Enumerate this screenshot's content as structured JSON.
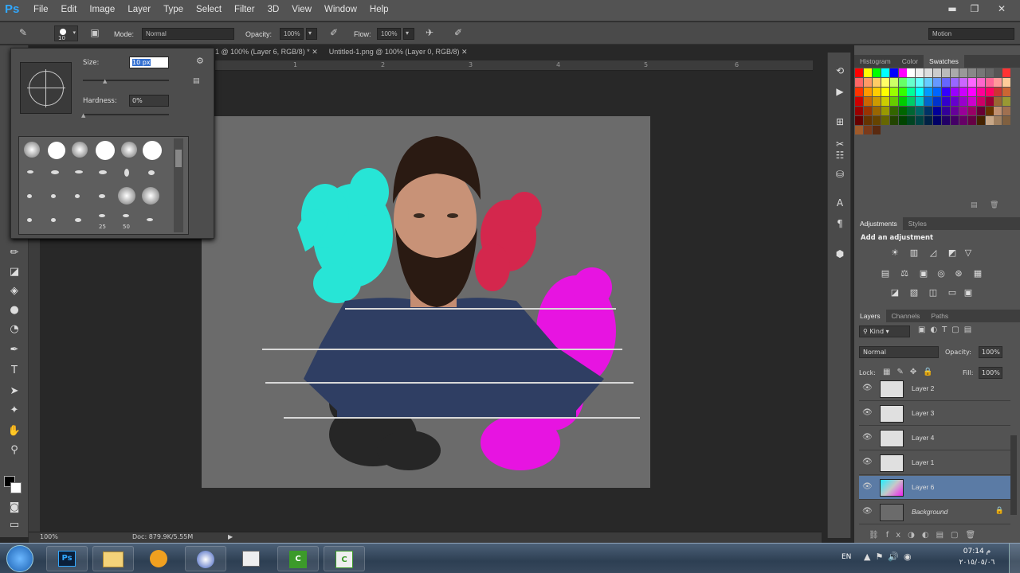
{
  "app": {
    "logo": "Ps",
    "menus": [
      "File",
      "Edit",
      "Image",
      "Layer",
      "Type",
      "Select",
      "Filter",
      "3D",
      "View",
      "Window",
      "Help"
    ]
  },
  "options_bar": {
    "brush_size": "10",
    "mode_label": "Mode:",
    "mode_value": "Normal",
    "opacity_label": "Opacity:",
    "opacity_value": "100%",
    "flow_label": "Flow:",
    "flow_value": "100%",
    "workspace": "Motion"
  },
  "brush_popup": {
    "size_label": "Size:",
    "size_value": "10 px",
    "hardness_label": "Hardness:",
    "hardness_value": "0%",
    "preset_numbers": [
      "25",
      "50"
    ]
  },
  "doc_tabs": [
    "1 @ 100% (Layer 6, RGB/8) *",
    "Untitled-1.png @ 100% (Layer 0, RGB/8)"
  ],
  "ruler_ticks": [
    "1",
    "2",
    "3",
    "4",
    "5",
    "6"
  ],
  "status": {
    "zoom": "100%",
    "doc_size": "Doc: 879.9K/5.55M"
  },
  "panels": {
    "color_tabs": [
      "Histogram",
      "Color",
      "Swatches"
    ],
    "adjust_tabs": [
      "Adjustments",
      "Styles"
    ],
    "adjust_hint": "Add an adjustment",
    "layer_tabs": [
      "Layers",
      "Channels",
      "Paths"
    ],
    "kind_label": "Kind",
    "blend_mode": "Normal",
    "opacity_label": "Opacity:",
    "opacity_value": "100%",
    "lock_label": "Lock:",
    "fill_label": "Fill:",
    "fill_value": "100%",
    "layers": [
      {
        "name": "Layer 2",
        "selected": false
      },
      {
        "name": "Layer 3",
        "selected": false
      },
      {
        "name": "Layer 4",
        "selected": false
      },
      {
        "name": "Layer 1",
        "selected": false
      },
      {
        "name": "Layer 6",
        "selected": true
      },
      {
        "name": "Background",
        "selected": false
      }
    ]
  },
  "taskbar": {
    "language": "EN",
    "time": "07:14 م",
    "date": "٢٠١٥/٠٥/٠٦"
  }
}
